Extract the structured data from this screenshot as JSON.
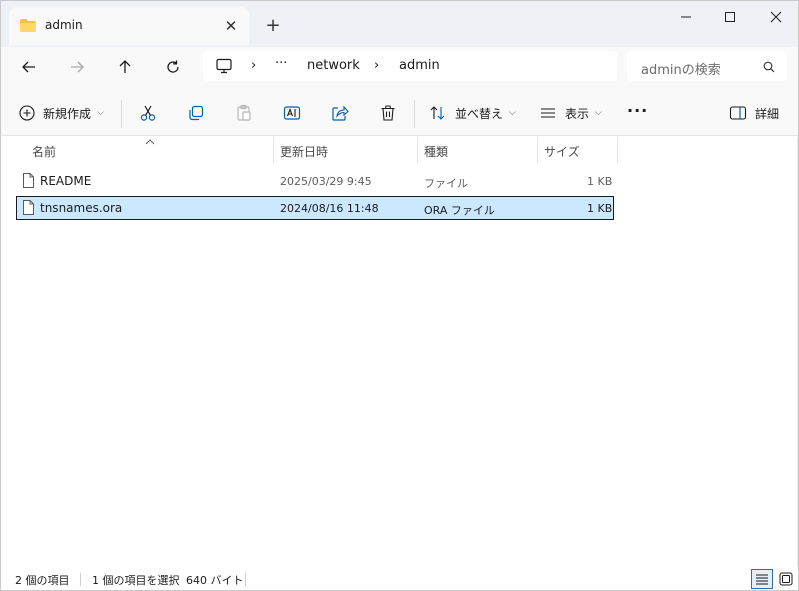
{
  "tab": {
    "title": "admin",
    "close_glyph": "✕",
    "new_tab_glyph": "+"
  },
  "window_controls": {
    "minimize": "—",
    "maximize": "☐",
    "close": "✕"
  },
  "address": {
    "more": "···",
    "crumbs": [
      "network",
      "admin"
    ],
    "separator": "›"
  },
  "search": {
    "placeholder": "adminの検索"
  },
  "commands": {
    "new": "新規作成",
    "sort": "並べ替え",
    "view": "表示",
    "more": "···",
    "details": "詳細"
  },
  "columns": [
    "名前",
    "更新日時",
    "種類",
    "サイズ"
  ],
  "files": [
    {
      "name": "README",
      "modified": "2025/03/29 9:45",
      "type": "ファイル",
      "size": "1 KB",
      "selected": false
    },
    {
      "name": "tnsnames.ora",
      "modified": "2024/08/16 11:48",
      "type": "ORA ファイル",
      "size": "1 KB",
      "selected": true
    }
  ],
  "status": {
    "count": "2 個の項目",
    "selection": "1 個の項目を選択",
    "size": "640 バイト"
  },
  "colors": {
    "accent": "#005fb8",
    "selection": "#cce8ff",
    "folder": "#f8c43a"
  }
}
